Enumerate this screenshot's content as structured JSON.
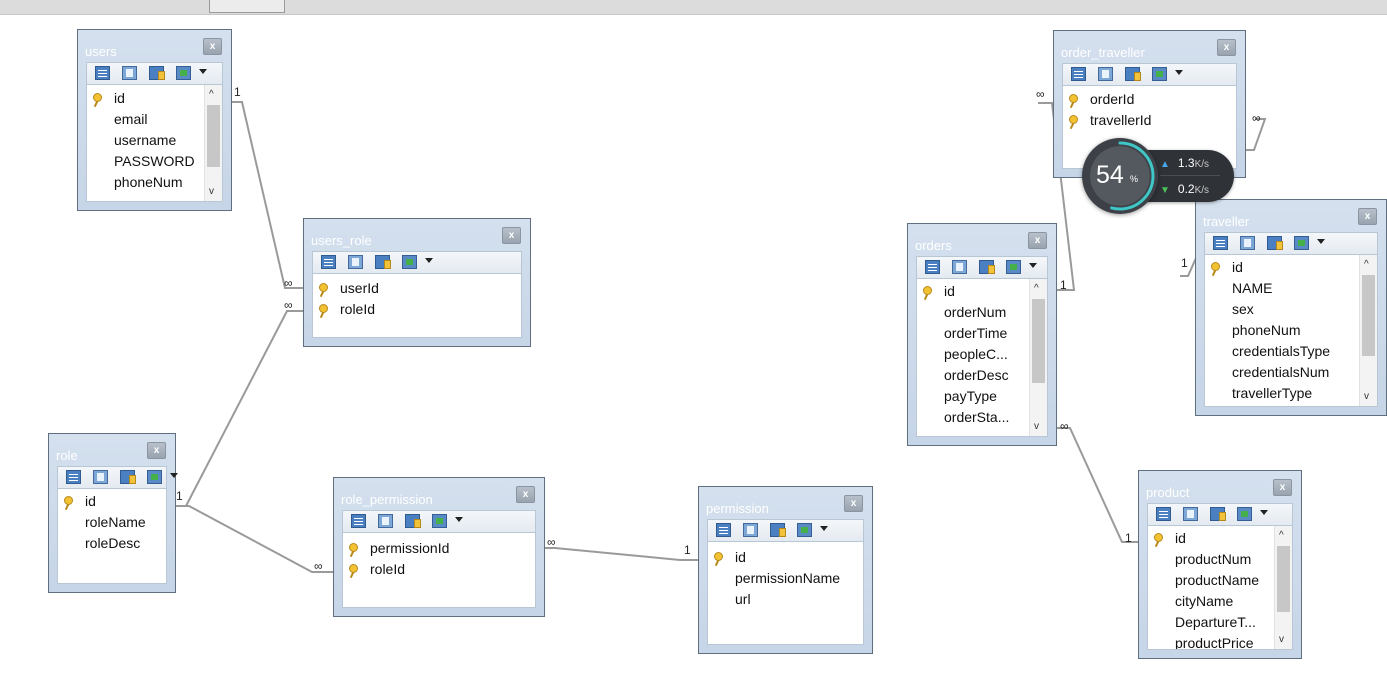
{
  "colors": {
    "table_frame": "#c6d5e7",
    "table_border": "#5f6f80",
    "relation_line": "#9a9a9a",
    "key_icon": "#f3c233",
    "speed_bg": "#2f3237",
    "speed_ring": "#3fc6c6",
    "speed_up": "#45a7e8",
    "speed_down": "#4cc35a"
  },
  "tables": {
    "users": {
      "title": "users",
      "columns": [
        {
          "name": "id",
          "key": true
        },
        {
          "name": "email"
        },
        {
          "name": "username"
        },
        {
          "name": "PASSWORD"
        },
        {
          "name": "phoneNum"
        }
      ]
    },
    "users_role": {
      "title": "users_role",
      "columns": [
        {
          "name": "userId",
          "key": true
        },
        {
          "name": "roleId",
          "key": true
        }
      ]
    },
    "role": {
      "title": "role",
      "columns": [
        {
          "name": "id",
          "key": true
        },
        {
          "name": "roleName"
        },
        {
          "name": "roleDesc"
        }
      ]
    },
    "role_permission": {
      "title": "role_permission",
      "columns": [
        {
          "name": "permissionId",
          "key": true
        },
        {
          "name": "roleId",
          "key": true
        }
      ]
    },
    "permission": {
      "title": "permission",
      "columns": [
        {
          "name": "id",
          "key": true
        },
        {
          "name": "permissionName"
        },
        {
          "name": "url"
        }
      ]
    },
    "orders": {
      "title": "orders",
      "columns": [
        {
          "name": "id",
          "key": true
        },
        {
          "name": "orderNum"
        },
        {
          "name": "orderTime"
        },
        {
          "name": "peopleC..."
        },
        {
          "name": "orderDesc"
        },
        {
          "name": "payType"
        },
        {
          "name": "orderSta..."
        }
      ]
    },
    "order_traveller": {
      "title": "order_traveller",
      "columns": [
        {
          "name": "orderId",
          "key": true
        },
        {
          "name": "travellerId",
          "key": true
        }
      ]
    },
    "traveller": {
      "title": "traveller",
      "columns": [
        {
          "name": "id",
          "key": true
        },
        {
          "name": "NAME"
        },
        {
          "name": "sex"
        },
        {
          "name": "phoneNum"
        },
        {
          "name": "credentialsType"
        },
        {
          "name": "credentialsNum"
        },
        {
          "name": "travellerType"
        }
      ]
    },
    "product": {
      "title": "product",
      "columns": [
        {
          "name": "id",
          "key": true
        },
        {
          "name": "productNum"
        },
        {
          "name": "productName"
        },
        {
          "name": "cityName"
        },
        {
          "name": "DepartureT..."
        },
        {
          "name": "productPrice"
        }
      ]
    }
  },
  "close_glyph": "x",
  "scroll_up_glyph": "^",
  "scroll_down_glyph": "v",
  "cardinality": {
    "one": "1",
    "many": "∞"
  },
  "speed_widget": {
    "percent": "54",
    "percent_sign": "%",
    "ring_fraction": 0.54,
    "upload": "1.3",
    "download": "0.2",
    "unit": "K/s",
    "up_icon": "arrow-up-icon",
    "down_icon": "arrow-down-icon"
  }
}
